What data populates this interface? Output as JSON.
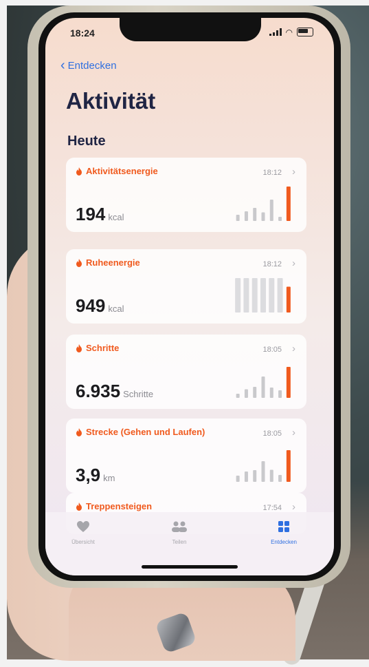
{
  "status": {
    "time": "18:24"
  },
  "nav": {
    "back_label": "Entdecken"
  },
  "title": "Aktivität",
  "section": "Heute",
  "cards": [
    {
      "label": "Aktivitätsenergie",
      "time": "18:12",
      "value": "194",
      "unit": "kcal",
      "bars": [
        0.18,
        0.28,
        0.38,
        0.25,
        0.62,
        0.12,
        1.0
      ],
      "style": "spark"
    },
    {
      "label": "Ruheenergie",
      "time": "18:12",
      "value": "949",
      "unit": "kcal",
      "bars": [
        1,
        1,
        1,
        1,
        1,
        1,
        0.75
      ],
      "style": "full"
    },
    {
      "label": "Schritte",
      "time": "18:05",
      "value": "6.935",
      "unit": "Schritte",
      "bars": [
        0.12,
        0.25,
        0.32,
        0.62,
        0.3,
        0.22,
        0.9
      ],
      "style": "spark"
    },
    {
      "label": "Strecke (Gehen und Laufen)",
      "time": "18:05",
      "value": "3,9",
      "unit": "km",
      "bars": [
        0.18,
        0.3,
        0.34,
        0.6,
        0.35,
        0.2,
        0.92
      ],
      "style": "spark"
    },
    {
      "label": "Treppensteigen",
      "time": "17:54",
      "value": "",
      "unit": "",
      "bars": [],
      "style": "none"
    }
  ],
  "tabs": [
    {
      "label": "Übersicht",
      "icon": "heart-icon"
    },
    {
      "label": "Teilen",
      "icon": "people-icon"
    },
    {
      "label": "Entdecken",
      "icon": "grid-icon"
    }
  ],
  "colors": {
    "accent": "#f05a1e",
    "link": "#2f6fe0",
    "bar_muted": "#c9c9cc"
  }
}
